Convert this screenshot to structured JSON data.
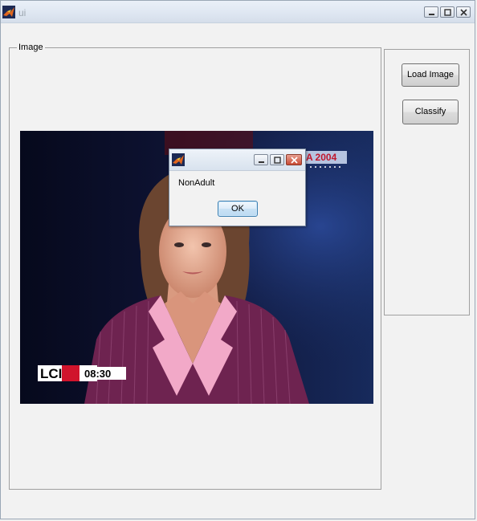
{
  "window": {
    "title": "ui",
    "controls": [
      "minimize-icon",
      "maximize-icon",
      "close-icon"
    ]
  },
  "image_panel": {
    "legend": "Image"
  },
  "buttons": {
    "load_image": "Load Image",
    "classify": "Classify"
  },
  "photo": {
    "overlay_left": "LCI",
    "clock": "08:30",
    "corner_text": "A 2004"
  },
  "dialog": {
    "message": "NonAdult",
    "ok_label": "OK"
  },
  "colors": {
    "titlebar": "#dfe7f2",
    "window_bg": "#f2f2f2",
    "jacket": "#6e2350",
    "lapel": "#f2a9c8"
  }
}
